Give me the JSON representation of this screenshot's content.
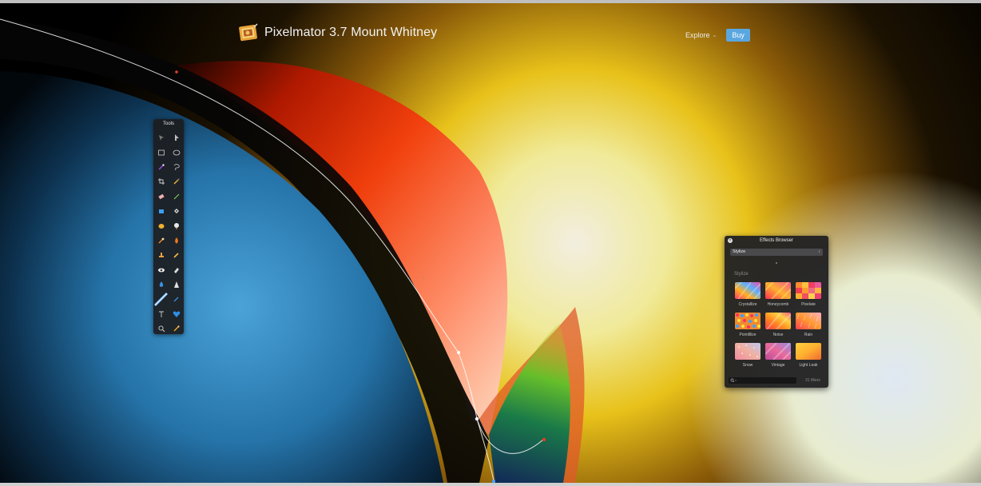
{
  "brand": {
    "title": "Pixelmator 3.7 Mount Whitney"
  },
  "nav": {
    "explore_label": "Explore",
    "buy_label": "Buy"
  },
  "tools": {
    "title": "Tools",
    "items": [
      "arrange-icon",
      "move-icon",
      "rect-select-icon",
      "ellipse-select-icon",
      "magic-wand-icon",
      "lasso-icon",
      "crop-icon",
      "eyedropper-icon",
      "eraser-icon",
      "brush-icon",
      "paint-bucket-icon",
      "gradient-icon",
      "shape-icon",
      "clone-icon",
      "smudge-icon",
      "burn-icon",
      "stamp-icon",
      "pencil-icon",
      "red-eye-icon",
      "sponge-icon",
      "blur-icon",
      "sharpen-icon",
      "pen-icon",
      "freeform-pen-icon",
      "type-icon",
      "heart-shape-icon",
      "zoom-icon",
      "warp-icon"
    ]
  },
  "effects_browser": {
    "title": "Effects Browser",
    "category_select": "Stylize",
    "section_label": "Stylize",
    "items": [
      {
        "label": "Crystallize"
      },
      {
        "label": "Honeycomb"
      },
      {
        "label": "Pixelate"
      },
      {
        "label": "Pointillize"
      },
      {
        "label": "Noise"
      },
      {
        "label": "Rain"
      },
      {
        "label": "Snow"
      },
      {
        "label": "Vintage"
      },
      {
        "label": "Light Leak"
      }
    ],
    "filter_count": "31 filters"
  },
  "colors": {
    "accent": "#5aa7e0",
    "panel": "#202022"
  }
}
